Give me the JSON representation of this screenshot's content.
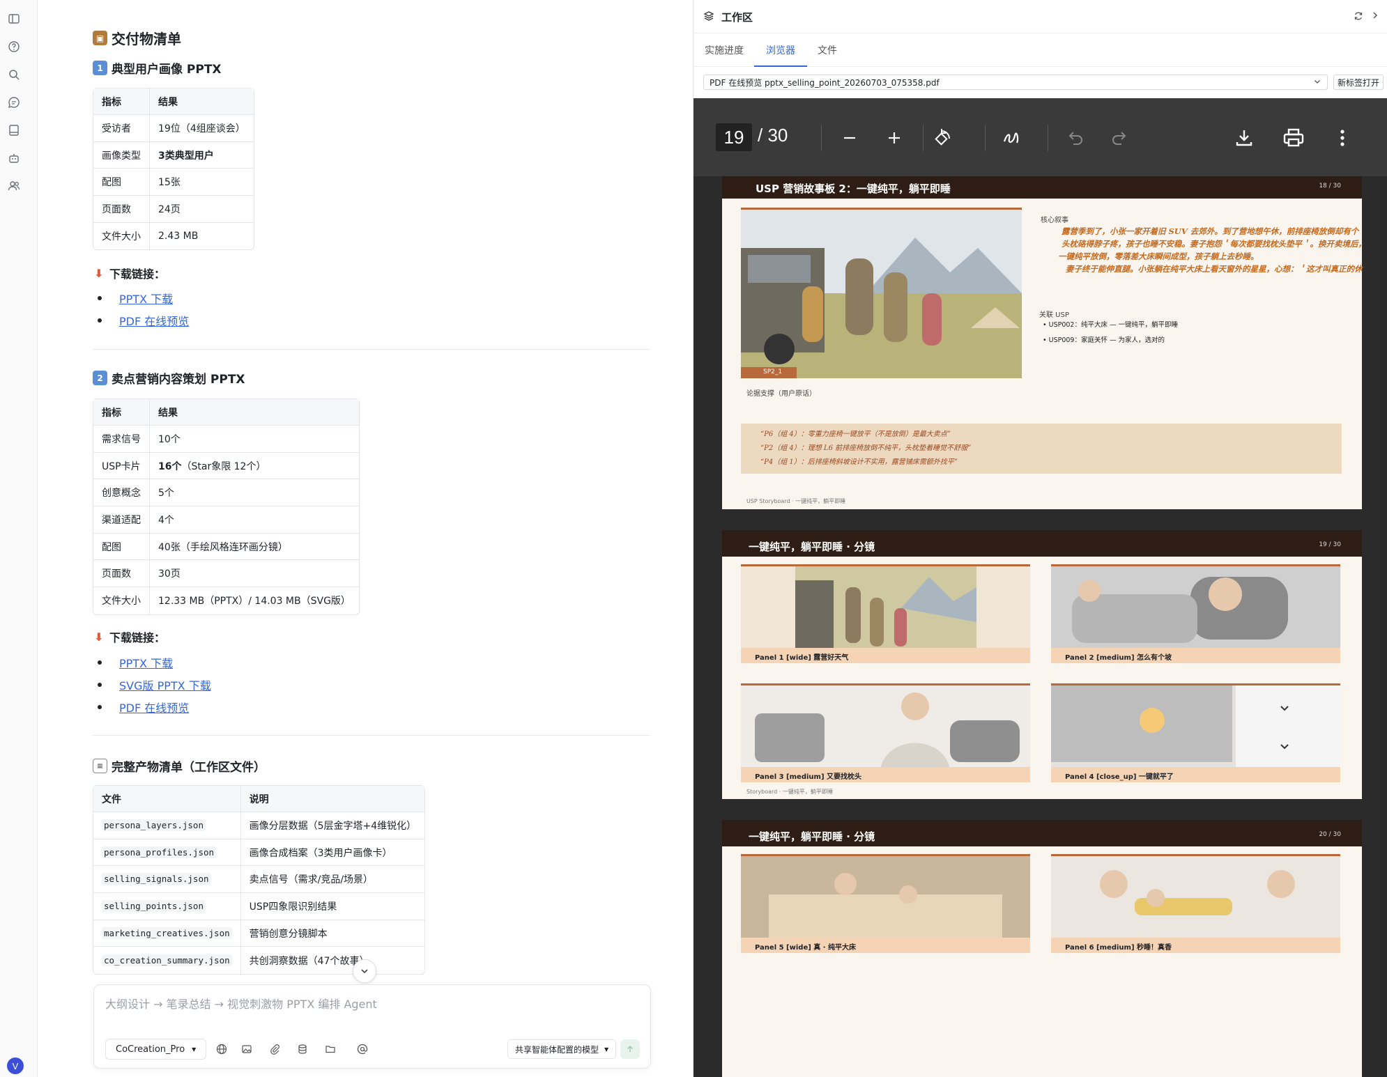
{
  "deliverables": {
    "title": "交付物清单",
    "section1": {
      "title": "典型用户画像 PPTX",
      "header": [
        "指标",
        "结果"
      ],
      "rows": [
        [
          "受访者",
          "19位（4组座谈会）"
        ],
        [
          "画像类型",
          "3类典型用户"
        ],
        [
          "配图",
          "15张"
        ],
        [
          "页面数",
          "24页"
        ],
        [
          "文件大小",
          "2.43 MB"
        ]
      ],
      "download_label": "下载链接：",
      "links": [
        "PPTX 下载",
        "PDF 在线预览"
      ]
    },
    "section2": {
      "title": "卖点营销内容策划 PPTX",
      "header": [
        "指标",
        "结果"
      ],
      "rows": [
        [
          "需求信号",
          "10个"
        ],
        [
          "USP卡片",
          "16个",
          "（Star象限 12个）"
        ],
        [
          "创意概念",
          "5个"
        ],
        [
          "渠道适配",
          "4个"
        ],
        [
          "配图",
          "40张（手绘风格连环画分镜）"
        ],
        [
          "页面数",
          "30页"
        ],
        [
          "文件大小",
          "12.33 MB（PPTX）/ 14.03 MB（SVG版）"
        ]
      ],
      "download_label": "下载链接：",
      "links": [
        "PPTX 下载",
        "SVG版 PPTX 下载",
        "PDF 在线预览"
      ]
    },
    "full_list": {
      "title": "完整产物清单（工作区文件）",
      "header": [
        "文件",
        "说明"
      ],
      "rows": [
        [
          "persona_layers.json",
          "画像分层数据（5层金字塔+4维锐化）"
        ],
        [
          "persona_profiles.json",
          "画像合成档案（3类用户画像卡）"
        ],
        [
          "selling_signals.json",
          "卖点信号（需求/竞品/场景）"
        ],
        [
          "selling_points.json",
          "USP四象限识别结果"
        ],
        [
          "marketing_creatives.json",
          "营销创意分镜脚本"
        ],
        [
          "co_creation_summary.json",
          "共创洞察数据（47个故事）"
        ]
      ]
    }
  },
  "composer": {
    "placeholder": "大纲设计 → 笔录总结 → 视觉刺激物 PPTX 编排 Agent",
    "agent": "CoCreation_Pro",
    "model": "共享智能体配置的模型"
  },
  "workspace": {
    "title": "工作区",
    "tabs": [
      "实施进度",
      "浏览器",
      "文件"
    ],
    "active_tab": "浏览器",
    "url": "PDF 在线预览 pptx_selling_point_20260703_075358.pdf",
    "new_tab": "新标签打开",
    "pdf": {
      "page": "19",
      "total": "/ 30"
    }
  },
  "slides": [
    {
      "title": "USP 营销故事板 2：一键纯平，躺平即睡",
      "num": "18 / 30",
      "img_tag": "SP2_1",
      "section_story": "核心叙事",
      "story": [
        "露营季到了，小张一家开着旧 SUV 去郊外。到了营地想午休，前排座椅放倒却有个",
        "头枕硌得脖子疼，孩子也睡不安稳。妻子抱怨＇每次都要找枕头垫平＇。换开卖境后，",
        "一键纯平放倒，零落差大床瞬间成型，孩子躺上去秒睡。",
        "妻子终于能伸直腿。小张躺在纯平大床上看天窗外的星星，心想：＇这才叫真正的休"
      ],
      "section_usp": "关联 USP",
      "usps": [
        "USP002：纯平大床 — 一键纯平，躺平即睡",
        "USP009：家庭关怀 — 为家人，选对的"
      ],
      "section_support": "论据支撑（用户原话）",
      "quotes": [
        "“P6（组 4）：零重力座椅一键放平（不是放倒）是最大卖点”",
        "“P2（组 4）：理想 L6 前排座椅放倒不纯平，头枕垫着睡觉不舒服”",
        "“P4（组 1）：后排座椅斜坡设计不实用，露营铺床需额外找平”"
      ],
      "footer": "USP Storyboard · 一键纯平，躺平即睡"
    },
    {
      "title": "一键纯平，躺平即睡 · 分镜",
      "num": "19 / 30",
      "panels": [
        "Panel 1 [wide] 露营好天气",
        "Panel 2 [medium] 怎么有个坡",
        "Panel 3 [medium] 又要找枕头",
        "Panel 4 [close_up] 一键就平了"
      ],
      "footer": "Storyboard · 一键纯平，躺平即睡"
    },
    {
      "title": "一键纯平，躺平即睡 · 分镜",
      "num": "20 / 30",
      "panels": [
        "Panel 5 [wide] 真 · 纯平大床",
        "Panel 6 [medium] 秒睡！真香"
      ]
    }
  ]
}
